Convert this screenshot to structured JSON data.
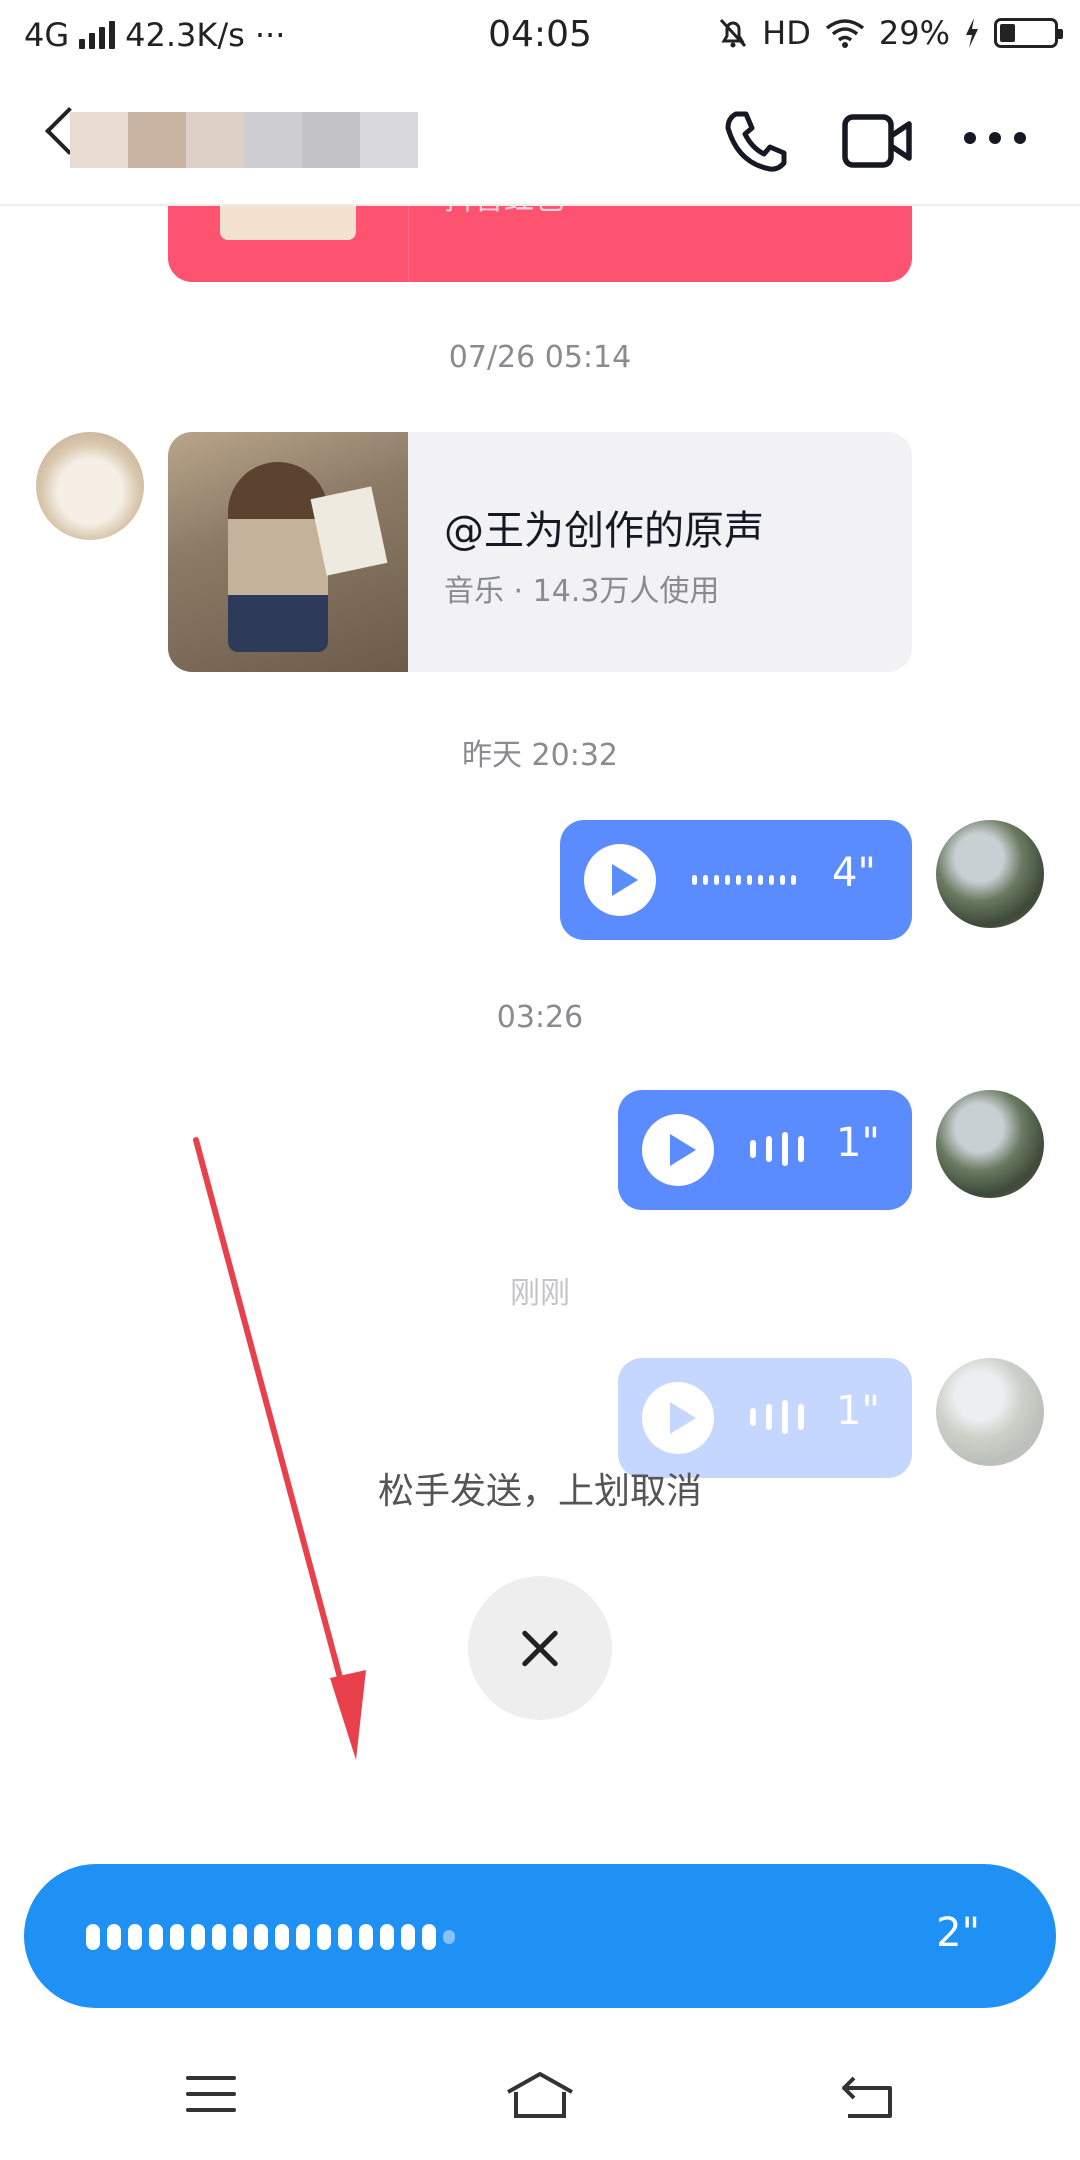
{
  "status_bar": {
    "network": "4G",
    "speed": "42.3K/s",
    "more": "···",
    "time": "04:05",
    "hd": "HD",
    "battery_percent": "29%",
    "battery_level": 0.29
  },
  "header": {
    "icons": [
      "back-icon",
      "phone-icon",
      "video-call-icon",
      "more-icon"
    ]
  },
  "messages": {
    "red_card_sub": "抖音红包",
    "ts1": "07/26 05:14",
    "music_title": "@王为创作的原声",
    "music_sub": "音乐 · 14.3万人使用",
    "ts2": "昨天 20:32",
    "voice1_duration": "4\"",
    "ts3": "03:26",
    "voice2_duration": "1\"",
    "ts4": "刚刚",
    "voice3_duration": "1\""
  },
  "recording": {
    "hint": "松手发送，上划取消",
    "duration": "2\""
  },
  "colors": {
    "accent_blue": "#1f91f5",
    "voice_bubble": "#5b8cff",
    "red_packet": "#fe5271",
    "annotation_arrow": "#e8414b"
  }
}
